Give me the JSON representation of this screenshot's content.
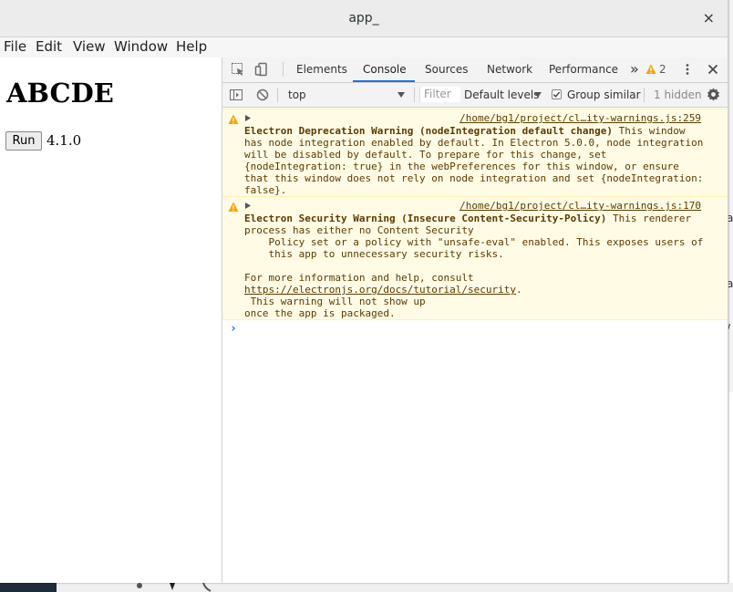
{
  "window": {
    "title": "app_",
    "close_glyph": "×"
  },
  "menu": [
    "File",
    "Edit",
    "View",
    "Window",
    "Help"
  ],
  "app": {
    "heading": "ABCDE",
    "run_label": "Run",
    "version": "4.1.0"
  },
  "devtools": {
    "tabs": [
      "Elements",
      "Console",
      "Sources",
      "Network",
      "Performance"
    ],
    "active_tab": "Console",
    "more_glyph": "»",
    "warning_count": "2",
    "context": "top",
    "filter_placeholder": "Filter",
    "levels": "Default levels",
    "group_similar": "Group similar",
    "hidden": "1 hidden",
    "accent_color": "#1a73e8"
  },
  "console": {
    "messages": [
      {
        "source": "/home/bg1/project/cl…ity-warnings.js:259",
        "bold": "Electron Deprecation Warning (nodeIntegration default change)",
        "line1_rest": " This window",
        "lines": [
          "has node integration enabled by default. In Electron 5.0.0, node integration",
          "will be disabled by default. To prepare for this change, set",
          "{nodeIntegration: true} in the webPreferences for this window, or ensure",
          "that this window does not rely on node integration and set {nodeIntegration:",
          "false}."
        ]
      },
      {
        "source": "/home/bg1/project/cl…ity-warnings.js:170",
        "bold": "Electron Security Warning (Insecure Content-Security-Policy)",
        "line1_rest": " This renderer",
        "lines": [
          "process has either no Content Security",
          "    Policy set or a policy with \"unsafe-eval\" enabled. This exposes users of",
          "    this app to unnecessary security risks.",
          "",
          "For more information and help, consult"
        ],
        "link": "https://electronjs.org/docs/tutorial/security",
        "after_link": ".",
        "tail": [
          " This warning will not show up",
          "once the app is packaged."
        ]
      }
    ],
    "prompt_glyph": "›"
  },
  "background": {
    "right_fragments": [
      "a",
      "a",
      "/"
    ]
  }
}
